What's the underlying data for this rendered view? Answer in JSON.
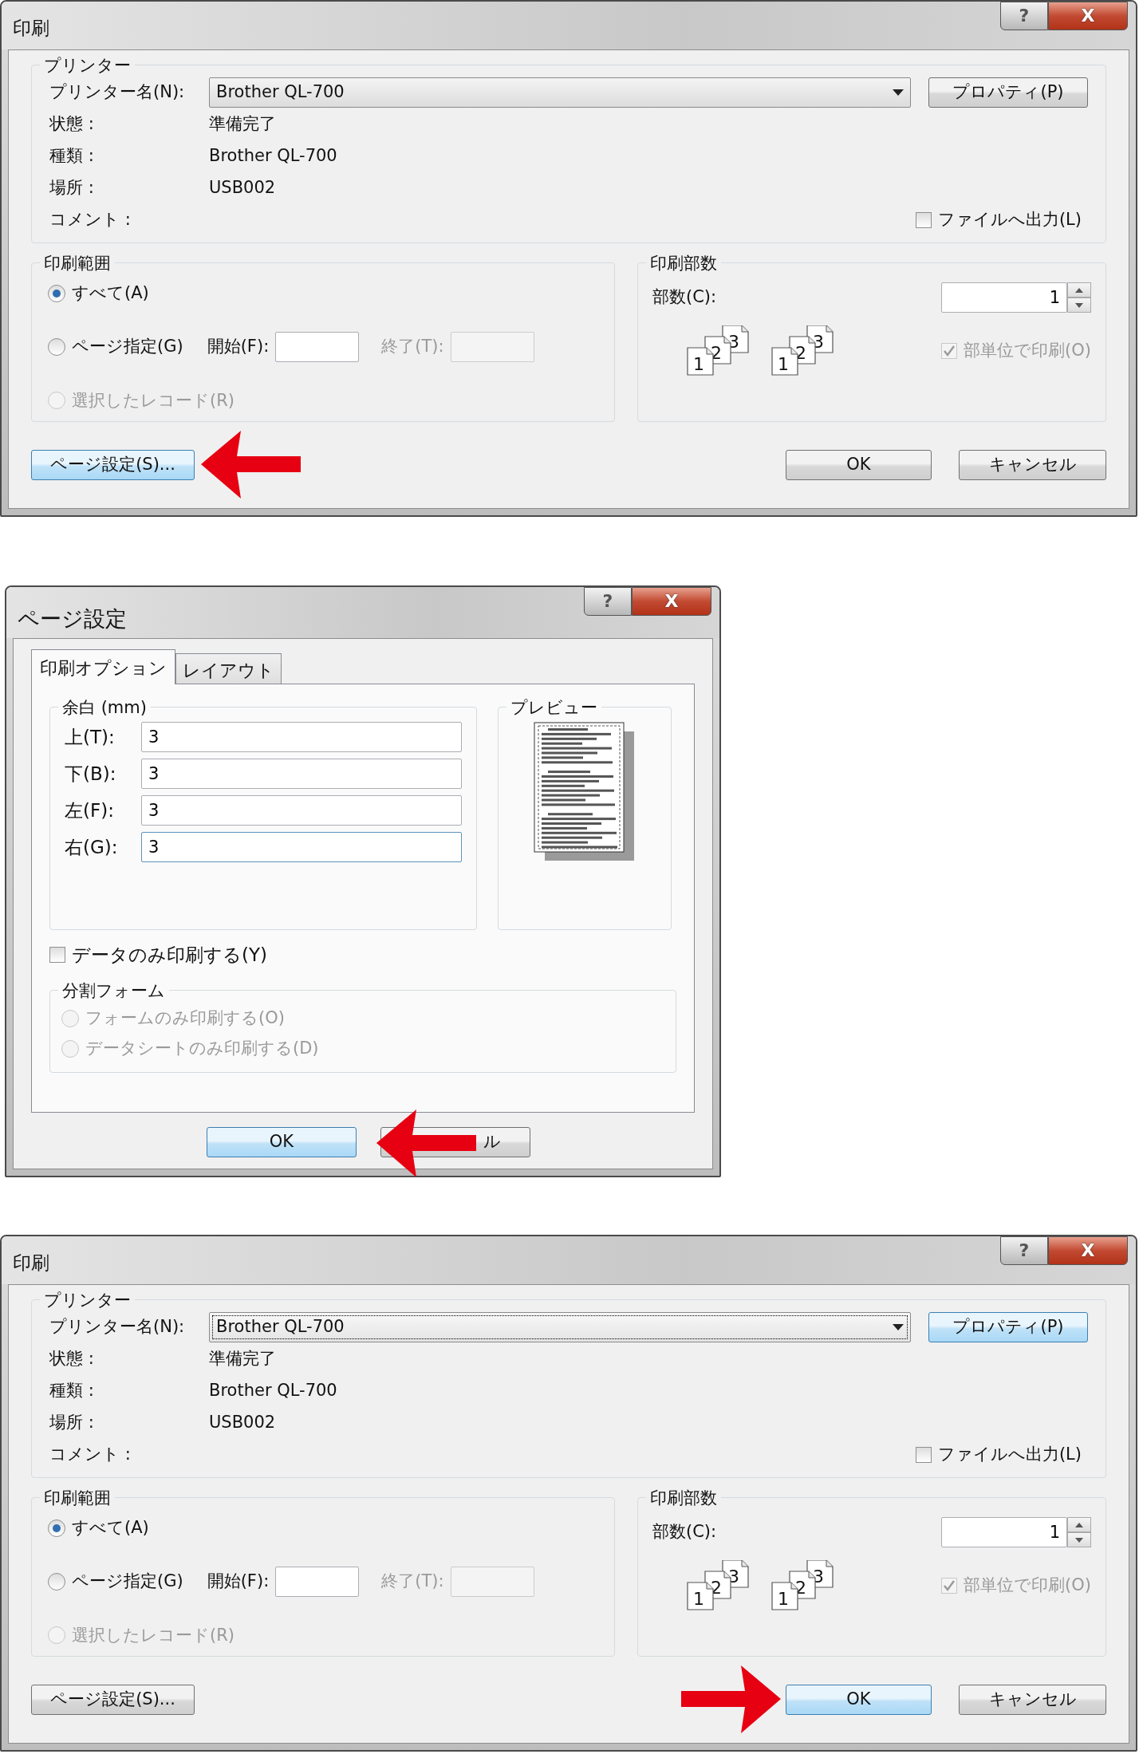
{
  "dialogs": [
    {
      "kind": "print",
      "title": "印刷",
      "help": "?",
      "close": "X",
      "printer": {
        "legend": "プリンター",
        "name_label": "プリンター名(N):",
        "name_value": "Brother QL-700",
        "name_focused": false,
        "properties": {
          "label": "プロパティ(P)",
          "highlighted": false
        },
        "info": [
          {
            "label": "状態 :",
            "value": "準備完了"
          },
          {
            "label": "種類 :",
            "value": "Brother QL-700"
          },
          {
            "label": "場所 :",
            "value": "USB002"
          },
          {
            "label": "コメント :"
          }
        ],
        "print_to_file": {
          "label": "ファイルへ出力(L)",
          "checked": false
        }
      },
      "range": {
        "legend": "印刷範囲",
        "options": [
          {
            "label": "すべて(A)",
            "selected": true,
            "disabled": false
          },
          {
            "label": "ページ指定(G)",
            "selected": false,
            "disabled": false,
            "from_label": "開始(F):",
            "to_label": "終了(T):",
            "to_disabled": true
          },
          {
            "label": "選択したレコード(R)",
            "selected": false,
            "disabled": true
          }
        ]
      },
      "copies": {
        "legend": "印刷部数",
        "count_label": "部数(C):",
        "count": "1",
        "collate_stacks": [
          [
            "1",
            "2",
            "3"
          ],
          [
            "1",
            "2",
            "3"
          ]
        ],
        "collate": {
          "label": "部単位で印刷(O)",
          "checked": true,
          "disabled": true
        }
      },
      "buttons": [
        {
          "kind": "page_setup",
          "label": "ページ設定(S)...",
          "focused": true,
          "arrow": {
            "kind": "left"
          }
        },
        {
          "kind": "ok",
          "label": "OK",
          "focused": false
        },
        {
          "kind": "cancel",
          "label": "キャンセル",
          "focused": false
        }
      ]
    },
    {
      "kind": "page_setup",
      "title": "ページ設定",
      "help": "?",
      "close": "X",
      "tabs": [
        {
          "label": "印刷オプション",
          "selected": true
        },
        {
          "label": "レイアウト",
          "selected": false
        }
      ],
      "margins": {
        "legend": "余白 (mm)",
        "fields": [
          {
            "label": "上(T):",
            "value": "3",
            "focused": false
          },
          {
            "label": "下(B):",
            "value": "3",
            "focused": false
          },
          {
            "label": "左(F):",
            "value": "3",
            "focused": false
          },
          {
            "label": "右(G):",
            "value": "3",
            "focused": true
          }
        ]
      },
      "preview": {
        "legend": "プレビュー"
      },
      "data_only": {
        "label": "データのみ印刷する(Y)",
        "checked": false
      },
      "split_form": {
        "legend": "分割フォーム",
        "options": [
          {
            "label": "フォームのみ印刷する(O)",
            "selected": false,
            "disabled": true
          },
          {
            "label": "データシートのみ印刷する(D)",
            "selected": false,
            "disabled": true
          }
        ]
      },
      "buttons": [
        {
          "kind": "ok",
          "label": "OK",
          "focused": true
        },
        {
          "kind": "cancel",
          "label": "ル",
          "focused": false,
          "arrow": {
            "kind": "over"
          }
        }
      ]
    },
    {
      "kind": "print",
      "title": "印刷",
      "help": "?",
      "close": "X",
      "printer": {
        "legend": "プリンター",
        "name_label": "プリンター名(N):",
        "name_value": "Brother QL-700",
        "name_focused": true,
        "properties": {
          "label": "プロパティ(P)",
          "highlighted": true
        },
        "info": [
          {
            "label": "状態 :",
            "value": "準備完了"
          },
          {
            "label": "種類 :",
            "value": "Brother QL-700"
          },
          {
            "label": "場所 :",
            "value": "USB002"
          },
          {
            "label": "コメント :"
          }
        ],
        "print_to_file": {
          "label": "ファイルへ出力(L)",
          "checked": false
        }
      },
      "range": {
        "legend": "印刷範囲",
        "options": [
          {
            "label": "すべて(A)",
            "selected": true,
            "disabled": false
          },
          {
            "label": "ページ指定(G)",
            "selected": false,
            "disabled": false,
            "from_label": "開始(F):",
            "to_label": "終了(T):",
            "to_disabled": true
          },
          {
            "label": "選択したレコード(R)",
            "selected": false,
            "disabled": true
          }
        ]
      },
      "copies": {
        "legend": "印刷部数",
        "count_label": "部数(C):",
        "count": "1",
        "collate_stacks": [
          [
            "1",
            "2",
            "3"
          ],
          [
            "1",
            "2",
            "3"
          ]
        ],
        "collate": {
          "label": "部単位で印刷(O)",
          "checked": true,
          "disabled": true
        }
      },
      "buttons": [
        {
          "kind": "page_setup",
          "label": "ページ設定(S)...",
          "focused": false
        },
        {
          "kind": "ok",
          "label": "OK",
          "focused": true,
          "arrow": {
            "kind": "right"
          }
        },
        {
          "kind": "cancel",
          "label": "キャンセル",
          "focused": false
        }
      ]
    }
  ]
}
